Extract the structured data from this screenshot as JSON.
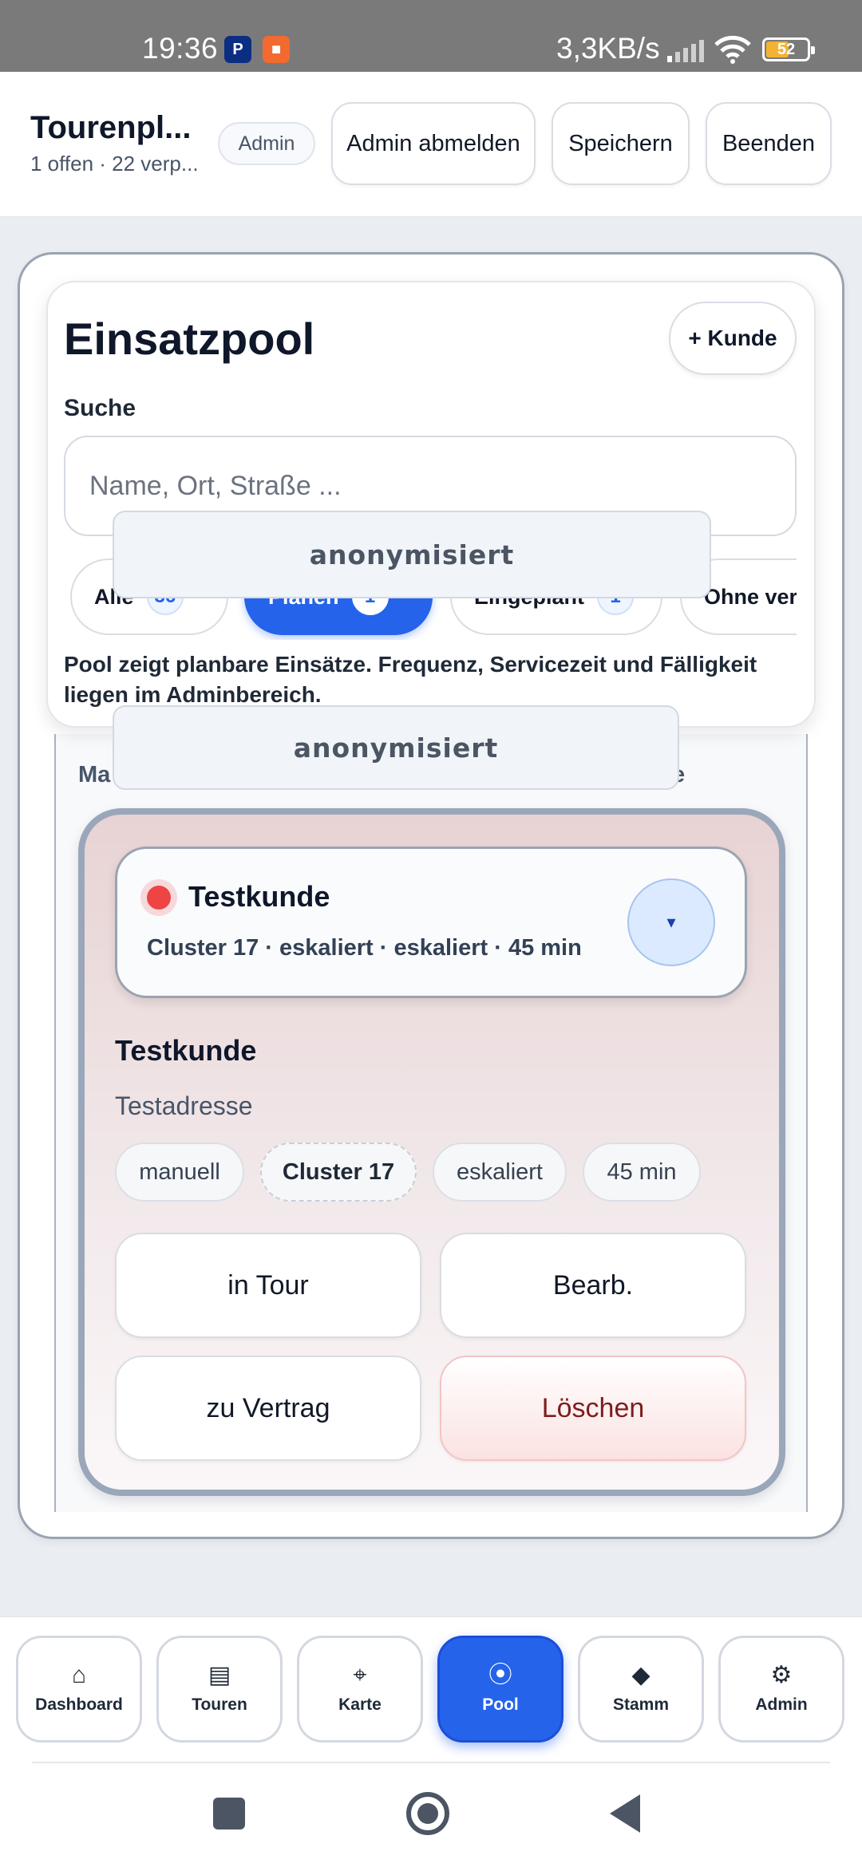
{
  "status_bar": {
    "time": "19:36",
    "network_speed": "3,3KB/s",
    "battery": "52",
    "icons": [
      "paypal-icon",
      "camera-icon",
      "signal-icon",
      "wifi-icon",
      "battery-icon"
    ]
  },
  "header": {
    "title": "Tourenpl...",
    "subtitle": "1 offen · 22 verp...",
    "role_badge": "Admin",
    "btn_logout": "Admin abmelden",
    "btn_save": "Speichern",
    "btn_exit": "Beenden"
  },
  "pool": {
    "title": "Einsatzpool",
    "add_customer": "+ Kunde",
    "search_label": "Suche",
    "search_placeholder": "Name, Ort, Straße ...",
    "filters": [
      {
        "label": "Alle",
        "count": "36"
      },
      {
        "label": "Planen",
        "count": "1"
      },
      {
        "label": "Eingeplant",
        "count": "1"
      },
      {
        "label": "Ohne ver",
        "count": ""
      }
    ],
    "active_filter": "Planen",
    "note": "Pool zeigt planbare Einsätze. Frequenz, Servicezeit und Fälligkeit liegen im Adminbereich.",
    "anonymized_1": "anonymisiert",
    "anonymized_2": "anonymisiert",
    "list_header_start": "Ma",
    "list_header_end": "e"
  },
  "selected_card": {
    "head_name": "Testkunde",
    "head_meta": "Cluster 17 · eskaliert · eskaliert · 45 min",
    "expand_glyph": "▾",
    "detail_name": "Testkunde",
    "address": "Testadresse",
    "tags": [
      "manuell",
      "Cluster 17",
      "eskaliert",
      "45 min"
    ],
    "btn_in_tour": "in Tour",
    "btn_edit": "Bearb.",
    "btn_contract": "zu Vertrag",
    "btn_delete": "Löschen",
    "status_color": "#ef4444"
  },
  "bottom_nav": [
    {
      "label": "Dashboard",
      "icon": "⌂"
    },
    {
      "label": "Touren",
      "icon": "▤"
    },
    {
      "label": "Karte",
      "icon": "⌖"
    },
    {
      "label": "Pool",
      "icon": "⦿"
    },
    {
      "label": "Stamm",
      "icon": "◆"
    },
    {
      "label": "Admin",
      "icon": "⚙"
    }
  ],
  "active_nav": "Pool",
  "colors": {
    "accent": "#2563eb",
    "danger_text": "#7f1d1d",
    "danger_bg": "#fbe2e2"
  }
}
